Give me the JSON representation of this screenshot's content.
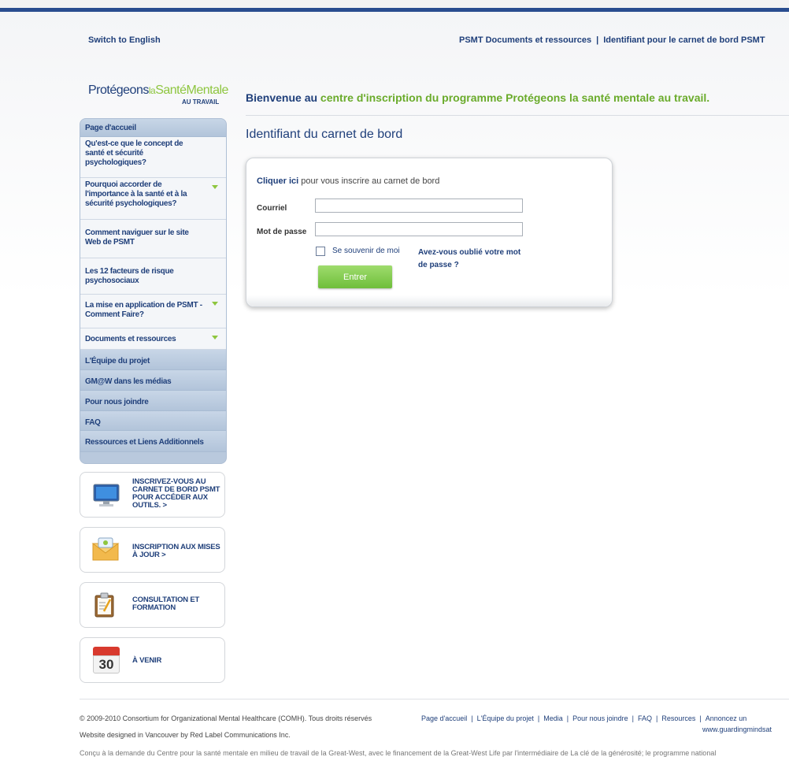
{
  "header": {
    "lang_switch": "Switch to English",
    "link_docs": "PSMT Documents et ressources",
    "separator": "|",
    "link_login": "Identifiant pour le carnet de bord PSMT"
  },
  "logo": {
    "part1": "Protégeons",
    "part2": "la",
    "part3": "SantéMentale",
    "sub": "AU TRAVAIL"
  },
  "welcome": {
    "prefix": "Bienvenue au",
    "highlight": "centre d'inscription du programme Protégeons la santé mentale au travail."
  },
  "section_title": "Identifiant du carnet de bord",
  "login": {
    "click_here": "Cliquer ici",
    "click_rest": " pour vous inscrire au carnet de bord",
    "email_label": "Courriel",
    "email_value": "",
    "password_label": "Mot de passe",
    "password_value": "",
    "remember_label": "Se souvenir de moi",
    "forgot_label": "Avez-vous oublié votre mot de passe ?",
    "submit_label": "Entrer"
  },
  "sidebar": {
    "items": [
      {
        "label": "Page d'accueil"
      },
      {
        "label": "Qu'est-ce que le concept de santé et sécurité psychologiques?"
      },
      {
        "label": "Pourquoi accorder de l'importance à la santé et à la sécurité psychologiques?"
      },
      {
        "label": "Comment naviguer sur le site Web de PSMT"
      },
      {
        "label": "Les 12 facteurs de risque psychosociaux"
      },
      {
        "label": "La mise en application de PSMT - Comment Faire?"
      },
      {
        "label": "Documents et ressources"
      },
      {
        "label": "L'Équipe du projet"
      },
      {
        "label": "GM@W dans les médias"
      },
      {
        "label": "Pour nous joindre"
      },
      {
        "label": "FAQ"
      },
      {
        "label": "Ressources et Liens Additionnels"
      }
    ]
  },
  "promos": [
    {
      "label": "INSCRIVEZ-VOUS AU CARNET DE BORD PSMT POUR ACCÉDER AUX OUTILS. >",
      "icon": "monitor-icon"
    },
    {
      "label": "INSCRIPTION AUX MISES À JOUR >",
      "icon": "envelope-icon"
    },
    {
      "label": "CONSULTATION ET FORMATION",
      "icon": "clipboard-icon"
    },
    {
      "label": "À VENIR",
      "icon": "calendar-icon",
      "calendar_day": "30"
    }
  ],
  "footer": {
    "copyright": "© 2009-2010 Consortium for Organizational Mental Healthcare (COMH). Tous droits réservés",
    "links": [
      "Page d'accueil",
      "L'Équipe du projet",
      "Media",
      "Pour nous joindre",
      "FAQ",
      "Resources",
      "Annoncez un"
    ],
    "link_separator": "|",
    "site": "www.guardingmindsat",
    "design": "Website designed in Vancouver by Red Label Communications Inc.",
    "bottom": "Conçu à la demande du Centre pour la santé mentale en milieu de travail de la Great-West, avec le financement de la Great-West Life par l'intermédiaire de La clé de la générosité; le programme national"
  },
  "colors": {
    "brand_blue": "#1f3f7a",
    "brand_green": "#8ec63f",
    "sidebar_bg": "#b9c9dd"
  }
}
